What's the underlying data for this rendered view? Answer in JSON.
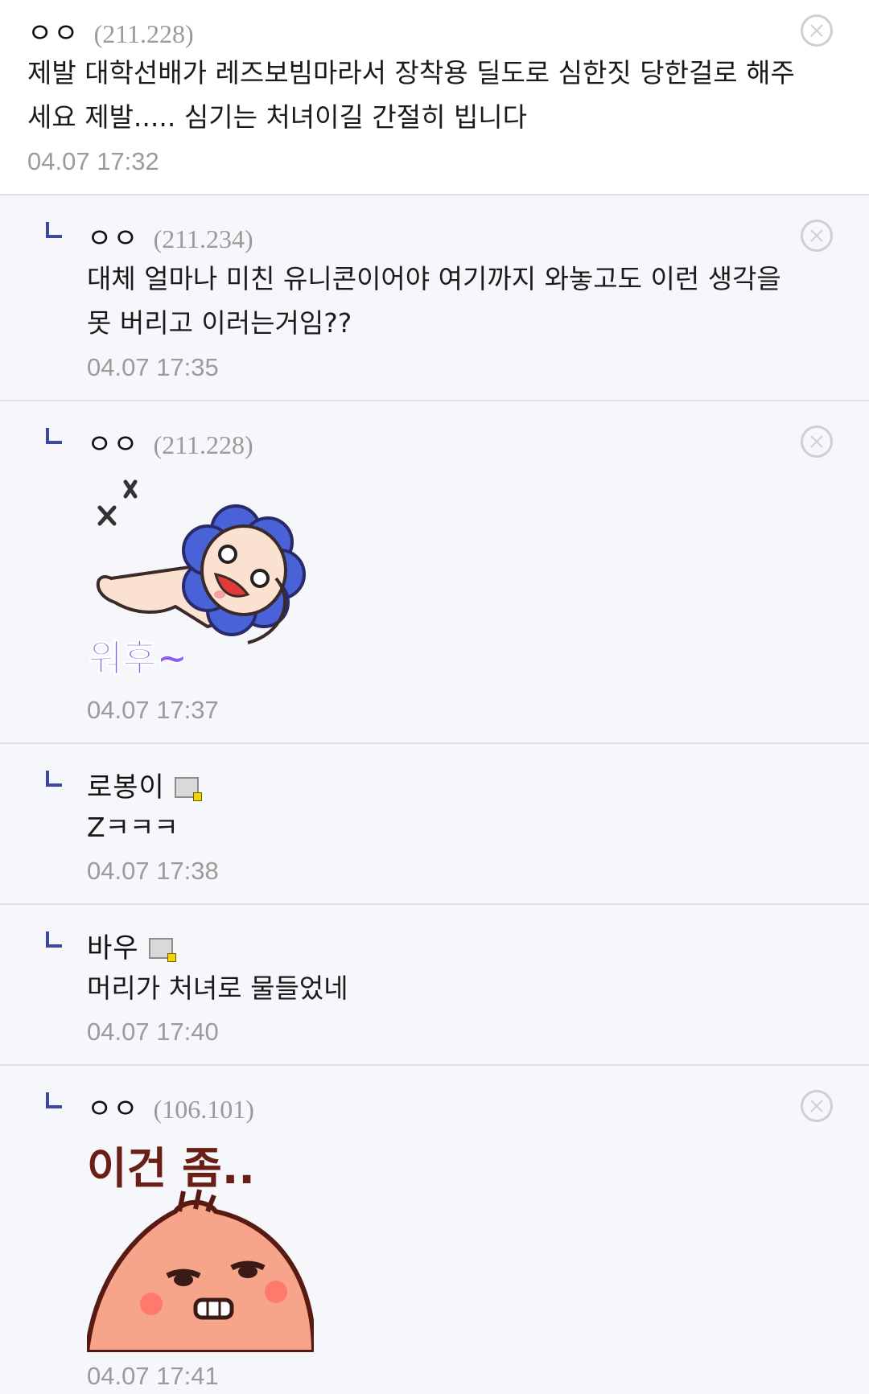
{
  "comments": [
    {
      "name": "ㅇㅇ",
      "ip": "(211.228)",
      "lines": [
        "제발 대학선배가 레즈보빔마라서 장착용 딜도로 심한짓 당한걸로 해주",
        "세요 제발..... 심기는 처녀이길 간절히 빕니다"
      ],
      "time": "04.07 17:32"
    },
    {
      "name": "ㅇㅇ",
      "ip": "(211.234)",
      "lines": [
        "대체 얼마나 미친 유니콘이어야 여기까지 와놓고도 이런 생각을",
        "못 버리고 이러는거임??"
      ],
      "time": "04.07 17:35"
    },
    {
      "name": "ㅇㅇ",
      "ip": "(211.228)",
      "sticker_text": "워후~",
      "time": "04.07 17:37"
    },
    {
      "name": "로봉이",
      "lines": [
        "Zㅋㅋㅋ"
      ],
      "time": "04.07 17:38"
    },
    {
      "name": "바우",
      "lines": [
        "머리가 처녀로 물들었네"
      ],
      "time": "04.07 17:40"
    },
    {
      "name": "ㅇㅇ",
      "ip": "(106.101)",
      "sticker_text": "이건 좀..",
      "time": "04.07 17:41"
    }
  ],
  "icons": {
    "reply": "reply-arrow-icon",
    "delete": "close-circle-icon",
    "member_badge": "gallery-member-icon"
  },
  "colors": {
    "reply_background": "#f6f7fa",
    "reply_mark": "#3b4aa0",
    "sticker_text_purple": "#8c5cf0",
    "sticker_text_brown": "#6a1e16"
  }
}
